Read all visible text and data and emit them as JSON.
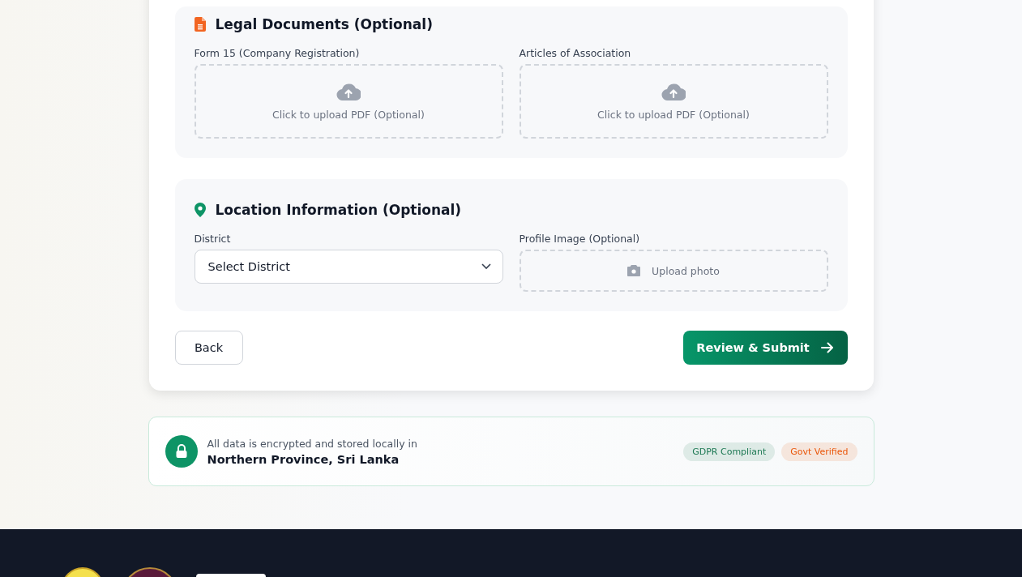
{
  "sections": [
    {
      "kind": "documents",
      "title": "Legal Documents (Optional)",
      "fields": [
        {
          "kind": "upload",
          "label": "Form 15 (Company Registration)",
          "text": "Click to upload PDF (Optional)"
        },
        {
          "kind": "upload",
          "label": "Articles of Association",
          "text": "Click to upload PDF (Optional)"
        }
      ]
    },
    {
      "kind": "location",
      "title": "Location Information (Optional)",
      "fields": [
        {
          "kind": "select",
          "label": "District",
          "placeholder": "Select District"
        },
        {
          "kind": "photo",
          "label": "Profile Image (Optional)",
          "text": "Upload photo"
        }
      ]
    }
  ],
  "actions": {
    "back": "Back",
    "submit": "Review & Submit"
  },
  "security_notice": {
    "text": "All data is encrypted and stored locally in",
    "location": "Northern Province, Sri Lanka",
    "badges": [
      {
        "label": "GDPR Compliant",
        "color": "#1f7a55"
      },
      {
        "label": "Govt Verified",
        "color": "#ea580c"
      }
    ]
  }
}
